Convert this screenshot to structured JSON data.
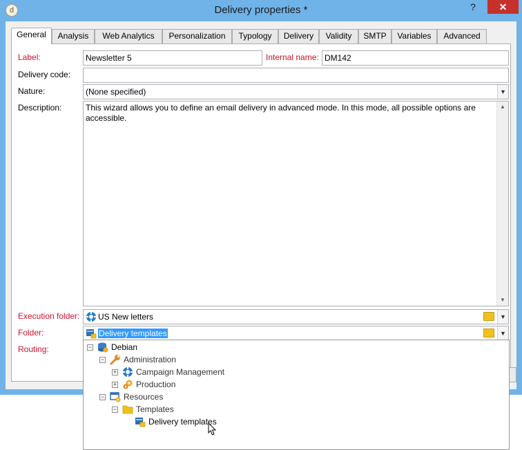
{
  "window": {
    "title": "Delivery properties *",
    "help_label": "?",
    "close_label": "✕"
  },
  "tabs": [
    {
      "label": "General",
      "active": true
    },
    {
      "label": "Analysis"
    },
    {
      "label": "Web Analytics"
    },
    {
      "label": "Personalization"
    },
    {
      "label": "Typology"
    },
    {
      "label": "Delivery"
    },
    {
      "label": "Validity"
    },
    {
      "label": "SMTP"
    },
    {
      "label": "Variables"
    },
    {
      "label": "Advanced"
    }
  ],
  "form": {
    "label_label": "Label:",
    "label_value": "Newsletter 5",
    "internal_name_label": "Internal name:",
    "internal_name_value": "DM142",
    "delivery_code_label": "Delivery code:",
    "delivery_code_value": "",
    "nature_label": "Nature:",
    "nature_value": "(None specified)",
    "description_label": "Description:",
    "description_value": "This wizard allows you to define an email delivery in advanced mode. In this mode, all possible options are accessible.",
    "execution_folder_label": "Execution folder:",
    "execution_folder_value": "US New letters",
    "folder_label": "Folder:",
    "folder_value": "Delivery templates",
    "routing_label": "Routing:"
  },
  "tree": {
    "items": [
      {
        "label": "Debian",
        "expander": "−",
        "icon": "database-icon"
      },
      {
        "label": "Administration",
        "expander": "−",
        "icon": "wrench-icon"
      },
      {
        "label": "Campaign Management",
        "expander": "+",
        "icon": "campaign-icon"
      },
      {
        "label": "Production",
        "expander": "+",
        "icon": "gears-icon"
      },
      {
        "label": "Resources",
        "expander": "−",
        "icon": "resources-icon"
      },
      {
        "label": "Templates",
        "expander": "−",
        "icon": "folder-icon"
      },
      {
        "label": "Delivery templates",
        "expander": "",
        "icon": "delivery-templates-icon"
      }
    ]
  },
  "colors": {
    "titlebar": "#6fb3e8",
    "close": "#c7312b",
    "required_label": "#c8102e",
    "selection": "#3399ff"
  }
}
